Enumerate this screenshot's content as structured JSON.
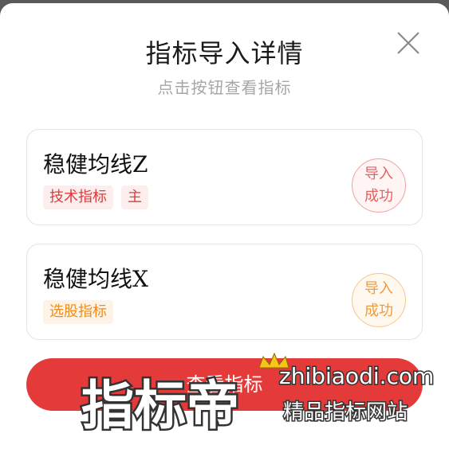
{
  "dialog": {
    "title": "指标导入详情",
    "subtitle": "点击按钮查看指标",
    "close_icon": "close-icon"
  },
  "cards": [
    {
      "name": "稳健均线Z",
      "tags": [
        "技术指标",
        "主"
      ],
      "status_line1": "导入",
      "status_line2": "成功",
      "accent": "#e03a3a"
    },
    {
      "name": "稳健均线X",
      "tags": [
        "选股指标"
      ],
      "status_line1": "导入",
      "status_line2": "成功",
      "accent": "#f08c1e"
    }
  ],
  "footer": {
    "view_button_label": "查看指标"
  },
  "watermark": {
    "brand": "指标帝",
    "url": "zhibiaodi.com",
    "slogan": "精品指标网站"
  }
}
